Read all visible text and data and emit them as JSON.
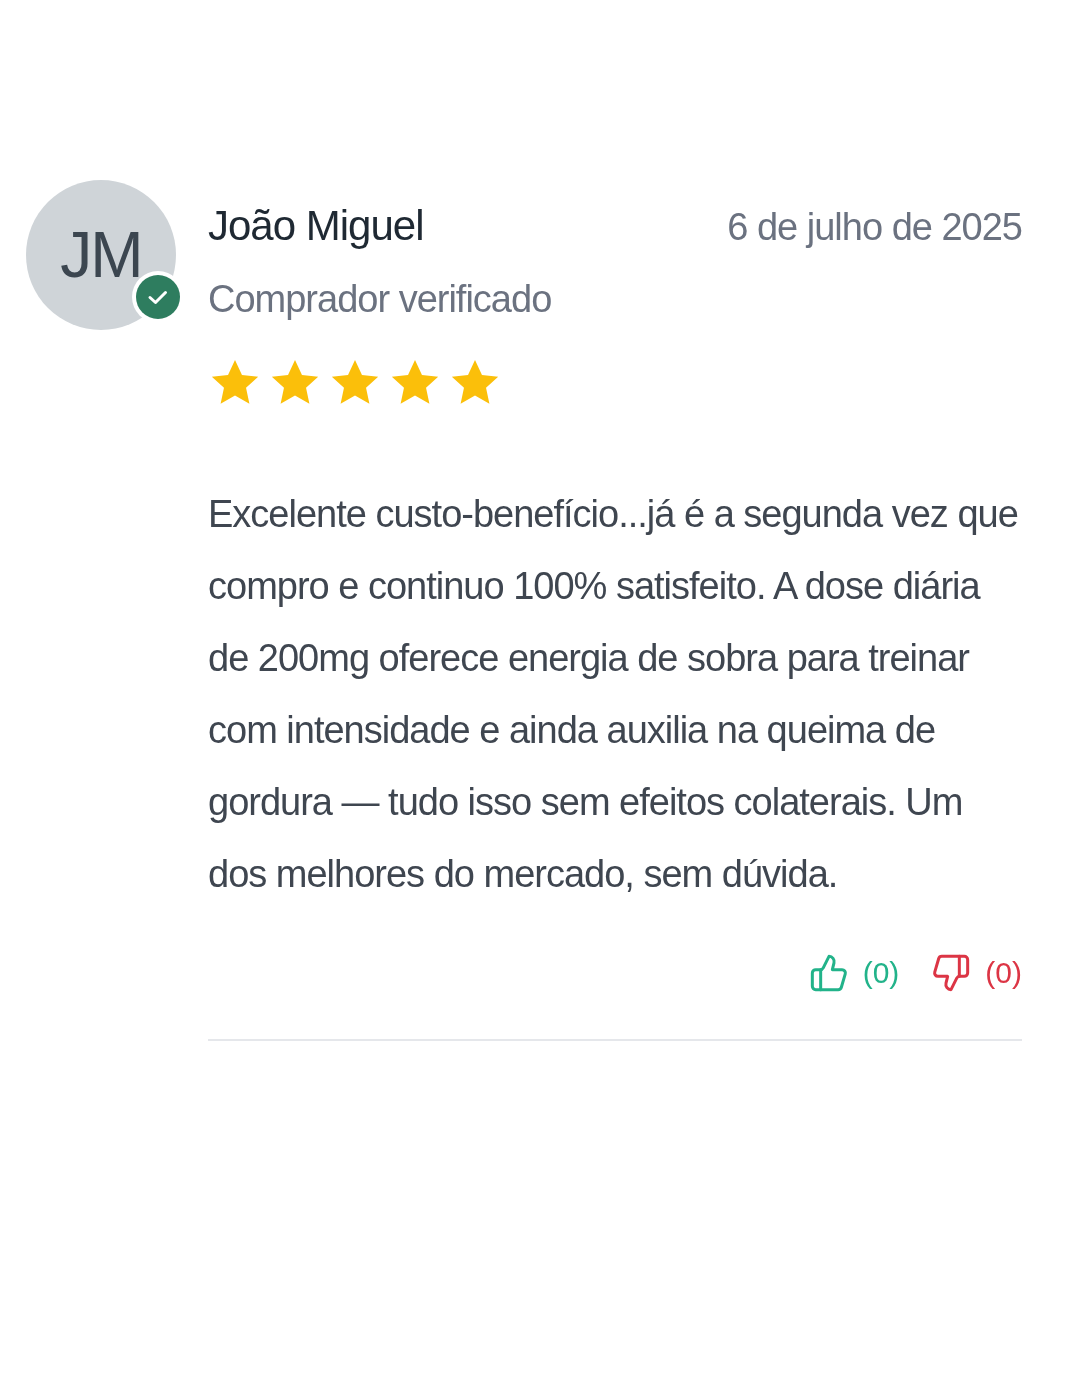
{
  "review": {
    "avatar_initials": "JM",
    "verified": true,
    "name": "João Miguel",
    "date": "6 de julho de 2025",
    "badge": "Comprador verificado",
    "stars": 5,
    "text": "Excelente custo-benefício...já é a segunda vez que compro e continuo 100% satisfeito. A dose diária de 200mg oferece energia de sobra para treinar com intensidade e ainda auxilia na queima de gordura — tudo isso sem efeitos colaterais. Um dos melhores do mercado, sem dúvida.",
    "helpful_count": "(0)",
    "unhelpful_count": "(0)"
  }
}
